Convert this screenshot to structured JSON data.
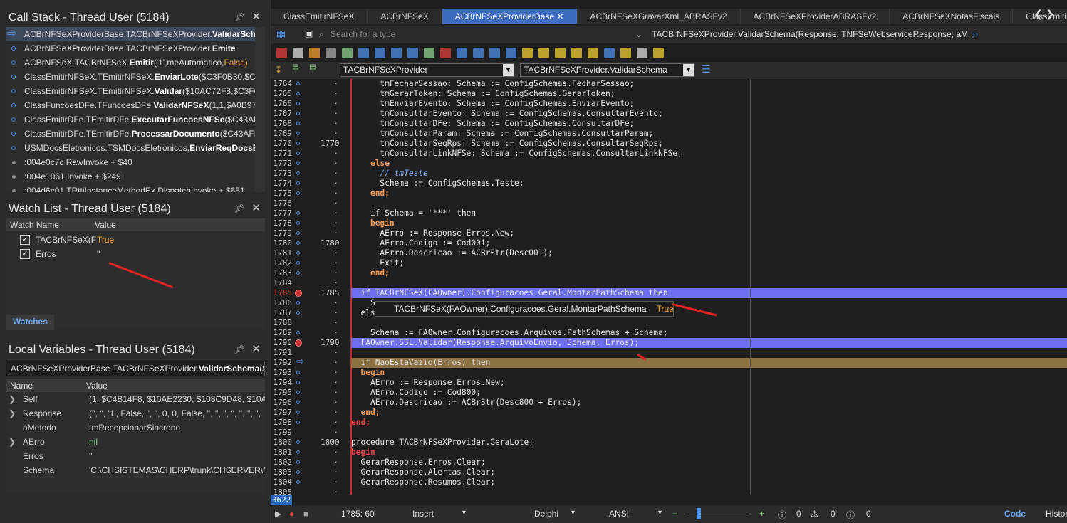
{
  "callstack": {
    "title": "Call Stack - Thread  User (5184)",
    "frames": [
      {
        "prefix": "ACBrNFSeXProviderBase.TACBrNFSeXProvider.",
        "method": "ValidarSchem",
        "args": ""
      },
      {
        "prefix": "ACBrNFSeXProviderBase.TACBrNFSeXProvider.",
        "method": "Emite",
        "args": ""
      },
      {
        "prefix": "ACBrNFSeX.TACBrNFSeX.",
        "method": "Emitir",
        "args": "('1',meAutomatico,",
        "extra": "False)"
      },
      {
        "prefix": "ClassEmitirNFSeX.TEmitirNFSeX.",
        "method": "EnviarLote",
        "args": "($C3F0B30,$C4B2",
        "extra": ""
      },
      {
        "prefix": "ClassEmitirNFSeX.TEmitirNFSeX.",
        "method": "Validar",
        "args": "($10AC72F8,$C3F0B30",
        "extra": ""
      },
      {
        "prefix": "ClassFuncoesDFe.TFuncoesDFe.",
        "method": "ValidarNFSeX",
        "args": "(1,1,$A0B97C0,",
        "extra": ""
      },
      {
        "prefix": "ClassEmitirDFe.TEmitirDFe.",
        "method": "ExecutarFuncoesNFSe",
        "args": "($C43AFB8",
        "extra": ""
      },
      {
        "prefix": "ClassEmitirDFe.TEmitirDFe.",
        "method": "ProcessarDocumento",
        "args": "($C43AFB8)",
        "extra": ""
      },
      {
        "prefix": "USMDocsEletronicos.TSMDocsEletronicos.",
        "method": "EnviarReqDocsEle",
        "args": "",
        "extra": ""
      },
      {
        "prefix": ":004e0c7c ",
        "method": "",
        "args": "RawInvoke + $40",
        "extra": ""
      },
      {
        "prefix": ":004e1061 ",
        "method": "",
        "args": "Invoke + $249",
        "extra": ""
      },
      {
        "prefix": ":004d6c01 ",
        "method": "",
        "args": "TRttiInstanceMethodEx.DispatchInvoke + $651",
        "extra": ""
      }
    ]
  },
  "watch": {
    "title": "Watch List - Thread  User (5184)",
    "col_name": "Watch Name",
    "col_value": "Value",
    "rows": [
      {
        "name": "TACBrNFSeX(F",
        "value": "True"
      },
      {
        "name": "Erros",
        "value": "''"
      }
    ],
    "tab": "Watches"
  },
  "locals": {
    "title": "Local Variables - Thread  User (5184)",
    "selector_prefix": "ACBrNFSeXProviderBase.TACBrNFSeXProvider.",
    "selector_method": "ValidarSchema",
    "selector_suffix": "($",
    "col_name": "Name",
    "col_value": "Value",
    "rows": [
      {
        "name": "Self",
        "value": "(1, $C4B14F8, $10AE2230, $108C9D48, $10ABBB",
        "exp": true
      },
      {
        "name": "Response",
        "value": "('', '', '1', False, '', '', 0, 0, False, '', '', '', '', '', '', '',",
        "exp": true
      },
      {
        "name": "aMetodo",
        "value": "tmRecepcionarSincrono",
        "exp": false
      },
      {
        "name": "AErro",
        "value": "nil",
        "exp": true
      },
      {
        "name": "Erros",
        "value": "''",
        "exp": false
      },
      {
        "name": "Schema",
        "value": "'C:\\CHSISTEMAS\\CHERP\\trunk\\CHSERVER\\NFS",
        "exp": false
      }
    ]
  },
  "tabs": [
    "ClassEmitirNFSeX",
    "ACBrNFSeX",
    "ACBrNFSeXProviderBase",
    "ACBrNFSeXGravarXml_ABRASFv2",
    "ACBrNFSeXProviderABRASFv2",
    "ACBrNFSeXNotasFiscais",
    "ClassEmitirDFe",
    "II"
  ],
  "active_tab": "ACBrNFSeXProviderBase",
  "search": {
    "placeholder": "Search for a type",
    "proto": "TACBrNFSeXProvider.ValidarSchema(Response: TNFSeWebserviceResponse; aM"
  },
  "combos": {
    "class": "TACBrNFSeXProvider",
    "method": "TACBrNFSeXProvider.ValidarSchema"
  },
  "tooltip": {
    "expr": "TACBrNFSeX(FAOwner).Configuracoes.Geral.MontarPathSchema",
    "value": "True"
  },
  "linecount": "3622",
  "lines": [
    {
      "n": "1764",
      "t": "  tmFecharSessao: Schema := ConfigSchemas.FecharSessao;"
    },
    {
      "n": "1765",
      "t": "  tmGerarToken: Schema := ConfigSchemas.GerarToken;"
    },
    {
      "n": "1766",
      "t": "  tmEnviarEvento: Schema := ConfigSchemas.EnviarEvento;"
    },
    {
      "n": "1767",
      "t": "  tmConsultarEvento: Schema := ConfigSchemas.ConsultarEvento;"
    },
    {
      "n": "1768",
      "t": "  tmConsultarDFe: Schema := ConfigSchemas.ConsultarDFe;"
    },
    {
      "n": "1769",
      "t": "  tmConsultarParam: Schema := ConfigSchemas.ConsultarParam;"
    },
    {
      "n": "1770",
      "t": "  tmConsultarSeqRps: Schema := ConfigSchemas.ConsultarSeqRps;"
    },
    {
      "n": "1771",
      "t": "  tmConsultarLinkNFSe: Schema := ConfigSchemas.ConsultarLinkNFSe;"
    },
    {
      "n": "1772",
      "t": "else"
    },
    {
      "n": "1773",
      "t": "  // tmTeste"
    },
    {
      "n": "1774",
      "t": "  Schema := ConfigSchemas.Teste;"
    },
    {
      "n": "1775",
      "t": "end;"
    },
    {
      "n": "1776",
      "t": ""
    },
    {
      "n": "1777",
      "t": "if Schema = '***' then"
    },
    {
      "n": "1778",
      "t": "begin"
    },
    {
      "n": "1779",
      "t": "  AErro := Response.Erros.New;"
    },
    {
      "n": "1780",
      "t": "  AErro.Codigo := Cod001;"
    },
    {
      "n": "1781",
      "t": "  AErro.Descricao := ACBrStr(Desc001);"
    },
    {
      "n": "1782",
      "t": "  Exit;"
    },
    {
      "n": "1783",
      "t": "end;"
    },
    {
      "n": "1784",
      "t": ""
    },
    {
      "n": "1785",
      "t": "if TACBrNFSeX(FAOwner).Configuracoes.Geral.MontarPathSchema then"
    },
    {
      "n": "1786",
      "t": "  S"
    },
    {
      "n": "1787",
      "t": "els"
    },
    {
      "n": "1788",
      "t": ""
    },
    {
      "n": "1789",
      "t": "  Schema := FAOwner.Configuracoes.Arquivos.PathSchemas + Schema;"
    },
    {
      "n": "1790",
      "t": "FAOwner.SSL.Validar(Response.ArquivoEnvio, Schema, Erros);"
    },
    {
      "n": "1791",
      "t": ""
    },
    {
      "n": "1792",
      "t": "if NaoEstaVazio(Erros) then"
    },
    {
      "n": "1793",
      "t": "begin"
    },
    {
      "n": "1794",
      "t": "  AErro := Response.Erros.New;"
    },
    {
      "n": "1795",
      "t": "  AErro.Codigo := Cod800;"
    },
    {
      "n": "1796",
      "t": "  AErro.Descricao := ACBrStr(Desc800 + Erros);"
    },
    {
      "n": "1797",
      "t": "end;"
    },
    {
      "n": "1798",
      "t": "end;"
    },
    {
      "n": "1799",
      "t": ""
    },
    {
      "n": "1800",
      "t": "procedure TACBrNFSeXProvider.GeraLote;"
    },
    {
      "n": "1801",
      "t": "begin"
    },
    {
      "n": "1802",
      "t": "  GerarResponse.Erros.Clear;"
    },
    {
      "n": "1803",
      "t": "  GerarResponse.Alertas.Clear;"
    },
    {
      "n": "1804",
      "t": "  GerarResponse.Resumos.Clear;"
    },
    {
      "n": "1805",
      "t": ""
    }
  ],
  "segments": [
    "1770",
    "1780",
    "1785",
    "1790",
    "1800"
  ],
  "status": {
    "position": "1785: 60",
    "mode": "Insert",
    "lang": "Delphi",
    "enc": "ANSI",
    "err": "0",
    "warn": "0",
    "info": "0",
    "code_tab": "Code",
    "history_tab": "History"
  },
  "colors": {
    "accent": "#3c6bc2",
    "highlight": "#6b6ff0",
    "exec": "#8c7240",
    "arrow": "#e52222"
  }
}
